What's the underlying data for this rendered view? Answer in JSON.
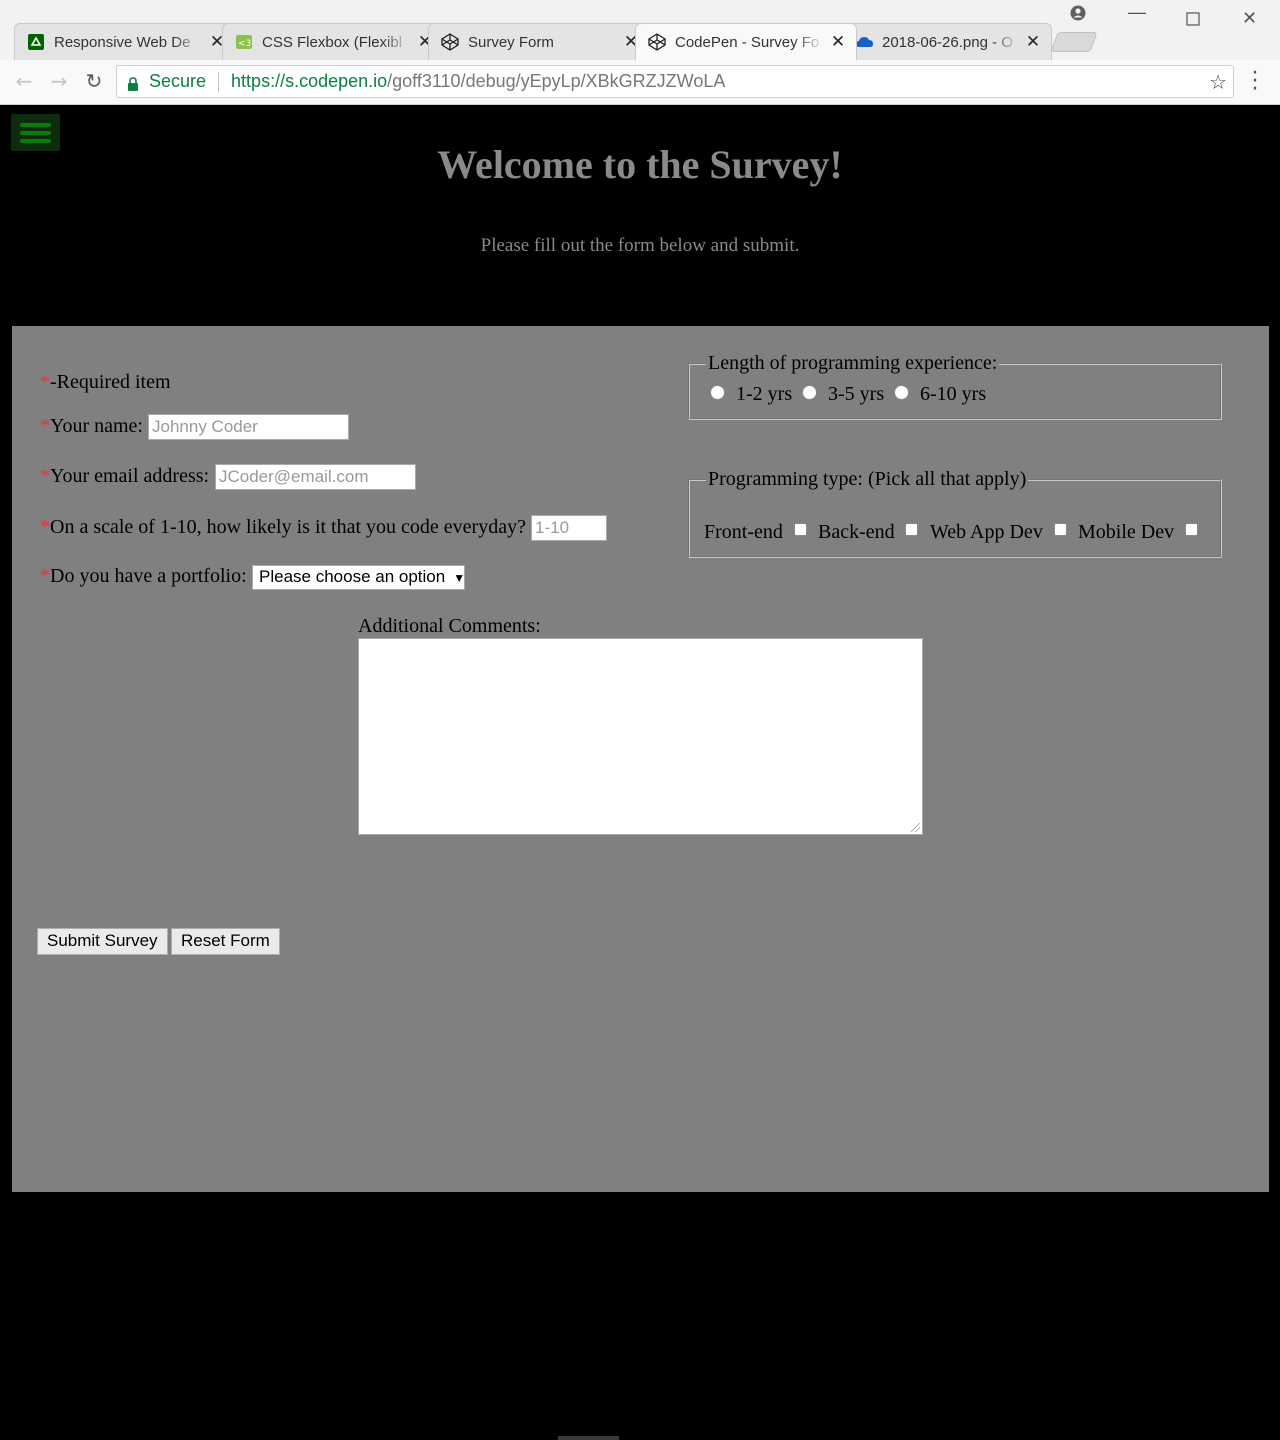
{
  "browser": {
    "tabs": [
      {
        "title": "Responsive Web De",
        "icon": "freecodecamp-icon",
        "active": false
      },
      {
        "title": "CSS Flexbox (Flexibl",
        "icon": "css3-icon",
        "active": false
      },
      {
        "title": "Survey Form",
        "icon": "codepen-icon",
        "active": false
      },
      {
        "title": "CodePen - Survey Fo",
        "icon": "codepen-icon",
        "active": true
      },
      {
        "title": "2018-06-26.png - O",
        "icon": "onedrive-icon",
        "active": false
      }
    ],
    "secure_label": "Secure",
    "url_host": "https://s.codepen.io",
    "url_path": "/goff3110/debug/yEpyLp/XBkGRZJZWoLA"
  },
  "page": {
    "title": "Welcome to the Survey!",
    "subtitle": "Please fill out the form below and submit.",
    "required_marker": "*",
    "required_note": "-Required item",
    "name_label": "Your name:",
    "name_placeholder": "Johnny Coder",
    "email_label": "Your email address:",
    "email_placeholder": "JCoder@email.com",
    "scale_label": "On a scale of 1-10, how likely is it that you code everyday?",
    "scale_placeholder": "1-10",
    "portfolio_label": "Do you have a portfolio:",
    "portfolio_selected": "Please choose an option",
    "experience_legend": "Length of programming experience:",
    "experience_options": [
      "1-2 yrs",
      "3-5 yrs",
      "6-10 yrs"
    ],
    "type_legend": "Programming type: (Pick all that apply)",
    "type_options": [
      "Front-end",
      "Back-end",
      "Web App Dev",
      "Mobile Dev"
    ],
    "comments_label": "Additional Comments:",
    "submit_label": "Submit Survey",
    "reset_label": "Reset Form"
  },
  "colors": {
    "page_background": "#000000",
    "form_background": "#808080",
    "heading_gray": "#8a8a8a",
    "required_red": "#ff2a2a",
    "secure_green": "#0b8043",
    "menu_green": "#0b7c0b"
  }
}
